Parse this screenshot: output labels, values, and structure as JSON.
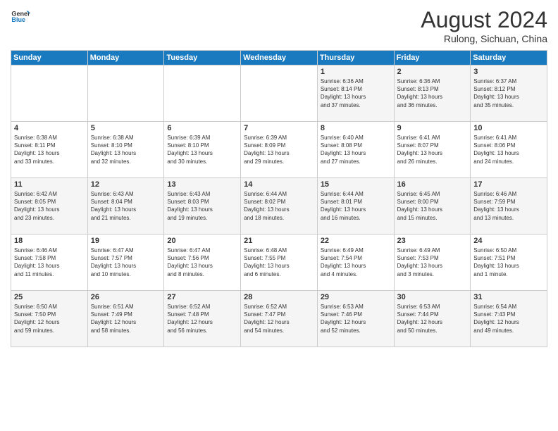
{
  "header": {
    "logo_line1": "General",
    "logo_line2": "Blue",
    "title": "August 2024",
    "location": "Rulong, Sichuan, China"
  },
  "days_of_week": [
    "Sunday",
    "Monday",
    "Tuesday",
    "Wednesday",
    "Thursday",
    "Friday",
    "Saturday"
  ],
  "weeks": [
    [
      {
        "day": "",
        "info": ""
      },
      {
        "day": "",
        "info": ""
      },
      {
        "day": "",
        "info": ""
      },
      {
        "day": "",
        "info": ""
      },
      {
        "day": "1",
        "info": "Sunrise: 6:36 AM\nSunset: 8:14 PM\nDaylight: 13 hours\nand 37 minutes."
      },
      {
        "day": "2",
        "info": "Sunrise: 6:36 AM\nSunset: 8:13 PM\nDaylight: 13 hours\nand 36 minutes."
      },
      {
        "day": "3",
        "info": "Sunrise: 6:37 AM\nSunset: 8:12 PM\nDaylight: 13 hours\nand 35 minutes."
      }
    ],
    [
      {
        "day": "4",
        "info": "Sunrise: 6:38 AM\nSunset: 8:11 PM\nDaylight: 13 hours\nand 33 minutes."
      },
      {
        "day": "5",
        "info": "Sunrise: 6:38 AM\nSunset: 8:10 PM\nDaylight: 13 hours\nand 32 minutes."
      },
      {
        "day": "6",
        "info": "Sunrise: 6:39 AM\nSunset: 8:10 PM\nDaylight: 13 hours\nand 30 minutes."
      },
      {
        "day": "7",
        "info": "Sunrise: 6:39 AM\nSunset: 8:09 PM\nDaylight: 13 hours\nand 29 minutes."
      },
      {
        "day": "8",
        "info": "Sunrise: 6:40 AM\nSunset: 8:08 PM\nDaylight: 13 hours\nand 27 minutes."
      },
      {
        "day": "9",
        "info": "Sunrise: 6:41 AM\nSunset: 8:07 PM\nDaylight: 13 hours\nand 26 minutes."
      },
      {
        "day": "10",
        "info": "Sunrise: 6:41 AM\nSunset: 8:06 PM\nDaylight: 13 hours\nand 24 minutes."
      }
    ],
    [
      {
        "day": "11",
        "info": "Sunrise: 6:42 AM\nSunset: 8:05 PM\nDaylight: 13 hours\nand 23 minutes."
      },
      {
        "day": "12",
        "info": "Sunrise: 6:43 AM\nSunset: 8:04 PM\nDaylight: 13 hours\nand 21 minutes."
      },
      {
        "day": "13",
        "info": "Sunrise: 6:43 AM\nSunset: 8:03 PM\nDaylight: 13 hours\nand 19 minutes."
      },
      {
        "day": "14",
        "info": "Sunrise: 6:44 AM\nSunset: 8:02 PM\nDaylight: 13 hours\nand 18 minutes."
      },
      {
        "day": "15",
        "info": "Sunrise: 6:44 AM\nSunset: 8:01 PM\nDaylight: 13 hours\nand 16 minutes."
      },
      {
        "day": "16",
        "info": "Sunrise: 6:45 AM\nSunset: 8:00 PM\nDaylight: 13 hours\nand 15 minutes."
      },
      {
        "day": "17",
        "info": "Sunrise: 6:46 AM\nSunset: 7:59 PM\nDaylight: 13 hours\nand 13 minutes."
      }
    ],
    [
      {
        "day": "18",
        "info": "Sunrise: 6:46 AM\nSunset: 7:58 PM\nDaylight: 13 hours\nand 11 minutes."
      },
      {
        "day": "19",
        "info": "Sunrise: 6:47 AM\nSunset: 7:57 PM\nDaylight: 13 hours\nand 10 minutes."
      },
      {
        "day": "20",
        "info": "Sunrise: 6:47 AM\nSunset: 7:56 PM\nDaylight: 13 hours\nand 8 minutes."
      },
      {
        "day": "21",
        "info": "Sunrise: 6:48 AM\nSunset: 7:55 PM\nDaylight: 13 hours\nand 6 minutes."
      },
      {
        "day": "22",
        "info": "Sunrise: 6:49 AM\nSunset: 7:54 PM\nDaylight: 13 hours\nand 4 minutes."
      },
      {
        "day": "23",
        "info": "Sunrise: 6:49 AM\nSunset: 7:53 PM\nDaylight: 13 hours\nand 3 minutes."
      },
      {
        "day": "24",
        "info": "Sunrise: 6:50 AM\nSunset: 7:51 PM\nDaylight: 13 hours\nand 1 minute."
      }
    ],
    [
      {
        "day": "25",
        "info": "Sunrise: 6:50 AM\nSunset: 7:50 PM\nDaylight: 12 hours\nand 59 minutes."
      },
      {
        "day": "26",
        "info": "Sunrise: 6:51 AM\nSunset: 7:49 PM\nDaylight: 12 hours\nand 58 minutes."
      },
      {
        "day": "27",
        "info": "Sunrise: 6:52 AM\nSunset: 7:48 PM\nDaylight: 12 hours\nand 56 minutes."
      },
      {
        "day": "28",
        "info": "Sunrise: 6:52 AM\nSunset: 7:47 PM\nDaylight: 12 hours\nand 54 minutes."
      },
      {
        "day": "29",
        "info": "Sunrise: 6:53 AM\nSunset: 7:46 PM\nDaylight: 12 hours\nand 52 minutes."
      },
      {
        "day": "30",
        "info": "Sunrise: 6:53 AM\nSunset: 7:44 PM\nDaylight: 12 hours\nand 50 minutes."
      },
      {
        "day": "31",
        "info": "Sunrise: 6:54 AM\nSunset: 7:43 PM\nDaylight: 12 hours\nand 49 minutes."
      }
    ]
  ]
}
